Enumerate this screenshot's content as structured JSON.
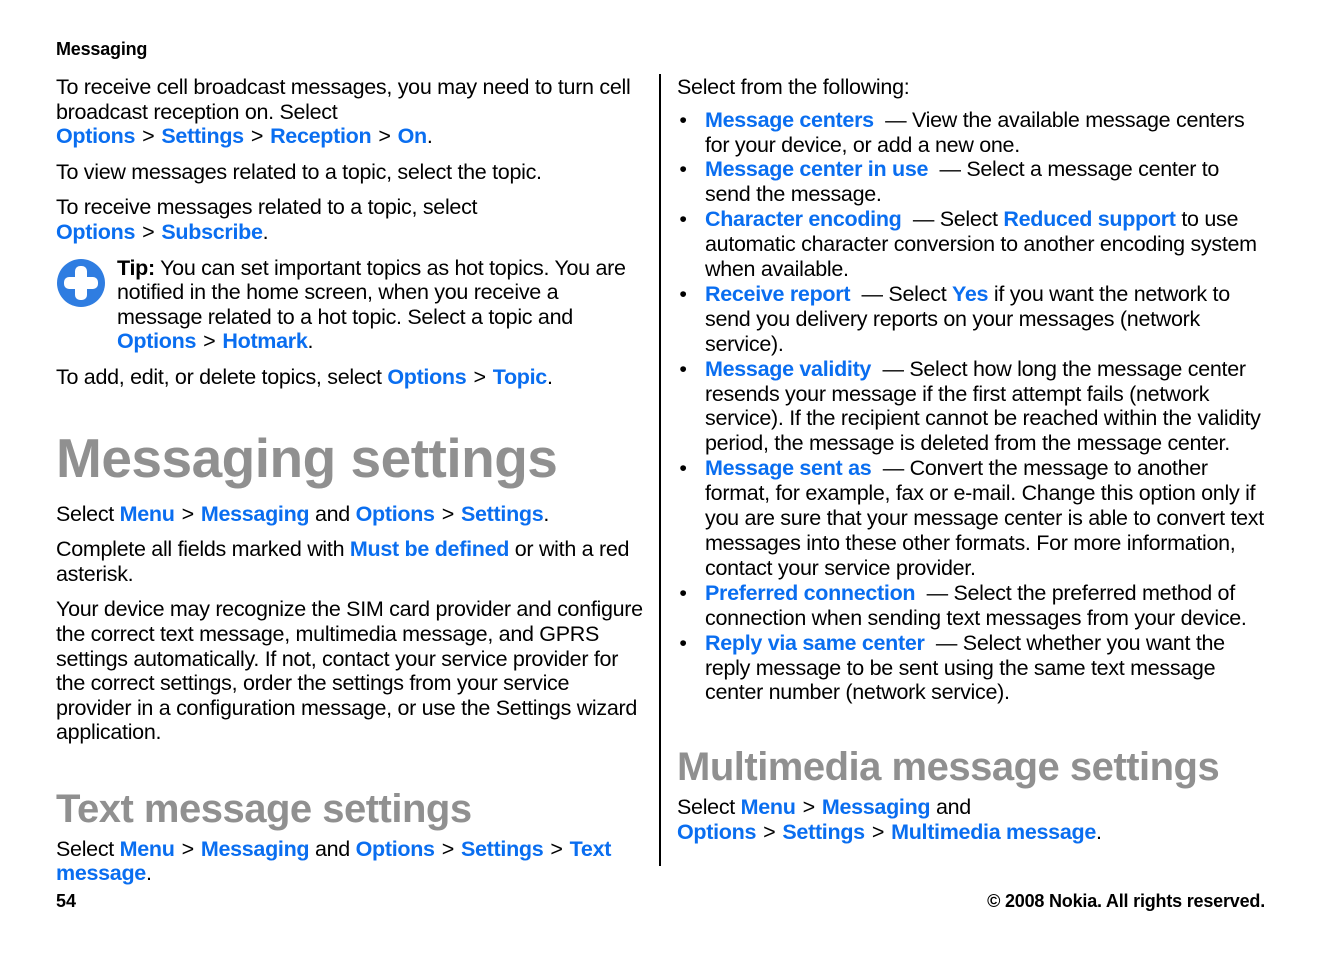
{
  "running_head": "Messaging",
  "footer": {
    "page_number": "54",
    "copyright": "© 2008 Nokia. All rights reserved."
  },
  "colors": {
    "link": "#0a6ef0",
    "heading": "#909090",
    "text": "#000000"
  },
  "left": {
    "p1": {
      "t1": "To receive cell broadcast messages, you may need to turn cell broadcast reception on. Select ",
      "l1": "Options",
      "s1": ">",
      "l2": "Settings",
      "s2": ">",
      "l3": "Reception",
      "s3": ">",
      "l4": "On",
      "end": "."
    },
    "p2": {
      "text": "To view messages related to a topic, select the topic."
    },
    "p3": {
      "t1": "To receive messages related to a topic, select ",
      "l1": "Options",
      "s1": ">",
      "l2": "Subscribe",
      "end": "."
    },
    "tip": {
      "icon": "plus-circle-icon",
      "label": "Tip:",
      "t1": " You can set important topics as hot topics. You are notified in the home screen, when you receive a message related to a hot topic. Select a topic and ",
      "l1": "Options",
      "s1": ">",
      "l2": "Hotmark",
      "end": "."
    },
    "p4": {
      "t1": "To add, edit, or delete topics, select ",
      "l1": "Options",
      "s1": ">",
      "l2": "Topic",
      "end": "."
    },
    "messaging_settings": {
      "title": "Messaging settings",
      "p1": {
        "t1": "Select ",
        "l1": "Menu",
        "s1": ">",
        "l2": "Messaging",
        "t2": " and ",
        "l3": "Options",
        "s2": ">",
        "l4": "Settings",
        "end": "."
      },
      "p2": {
        "t1": "Complete all fields marked with ",
        "l1": "Must be defined",
        "t2": " or with a red asterisk."
      },
      "p3": {
        "text": "Your device may recognize the SIM card provider and configure the correct text message, multimedia message, and GPRS settings automatically. If not, contact your service provider for the correct settings, order the settings from your service provider in a configuration message, or use the Settings wizard application."
      }
    },
    "text_message_settings": {
      "title": "Text message settings",
      "p1": {
        "t1": "Select ",
        "l1": "Menu",
        "s1": ">",
        "l2": "Messaging",
        "t2": " and ",
        "l3": "Options",
        "s2": ">",
        "l4": "Settings",
        "s3": ">",
        "l5": "Text message",
        "end": "."
      }
    }
  },
  "right": {
    "intro": "Select from the following:",
    "bullet": "•",
    "items": [
      {
        "link": "Message centers",
        "t1": "  — View the available message centers for your device, or add a new one."
      },
      {
        "link": "Message center in use",
        "t1": "  — Select a message center to send the message."
      },
      {
        "link": "Character encoding",
        "t1": "  — Select ",
        "link2": "Reduced support",
        "t2": " to use automatic character conversion to another encoding system when available."
      },
      {
        "link": "Receive report",
        "t1": "  — Select ",
        "link2": "Yes",
        "t2": " if you want the network to send you delivery reports on your messages (network service)."
      },
      {
        "link": "Message validity",
        "t1": "  — Select how long the message center resends your message if the first attempt fails (network service). If the recipient cannot be reached within the validity period, the message is deleted from the message center."
      },
      {
        "link": "Message sent as",
        "t1": "  — Convert the message to another format, for example, fax or e-mail. Change this option only if you are sure that your message center is able to convert text messages into these other formats. For more information, contact your service provider."
      },
      {
        "link": "Preferred connection",
        "t1": "  — Select the preferred method of connection when sending text messages from your device."
      },
      {
        "link": "Reply via same center",
        "t1": "  — Select whether you want the reply message to be sent using the same text message center number (network service)."
      }
    ],
    "multimedia_message_settings": {
      "title": "Multimedia message settings",
      "p1": {
        "t1": "Select ",
        "l1": "Menu",
        "s1": ">",
        "l2": "Messaging",
        "t2": " and ",
        "l3": "Options",
        "s2": ">",
        "l4": "Settings",
        "s3": ">",
        "l5": "Multimedia message",
        "end": "."
      }
    }
  }
}
